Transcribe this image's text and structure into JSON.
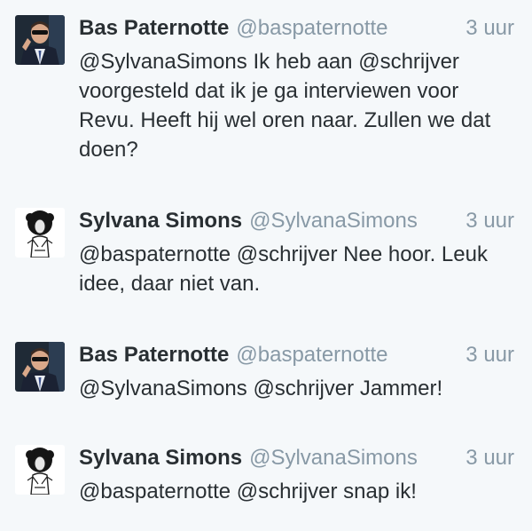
{
  "tweets": [
    {
      "name": "Bas Paternotte",
      "handle": "@baspaternotte",
      "time": "3 uur",
      "text": "@SylvanaSimons Ik heb aan @schrijver voorgesteld dat ik je ga interviewen voor Revu. Heeft hij wel oren naar. Zullen we dat doen?",
      "avatar": "bas-avatar"
    },
    {
      "name": "Sylvana Simons",
      "handle": "@SylvanaSimons",
      "time": "3 uur",
      "text": "@baspaternotte @schrijver Nee hoor. Leuk idee, daar niet van.",
      "avatar": "sylvana-avatar"
    },
    {
      "name": "Bas Paternotte",
      "handle": "@baspaternotte",
      "time": "3 uur",
      "text": "@SylvanaSimons @schrijver Jammer!",
      "avatar": "bas-avatar"
    },
    {
      "name": "Sylvana Simons",
      "handle": "@SylvanaSimons",
      "time": "3 uur",
      "text": "@baspaternotte @schrijver snap ik!",
      "avatar": "sylvana-avatar"
    }
  ],
  "colors": {
    "background": "#f5f8fa",
    "text": "#292f33",
    "muted": "#8899a6"
  }
}
